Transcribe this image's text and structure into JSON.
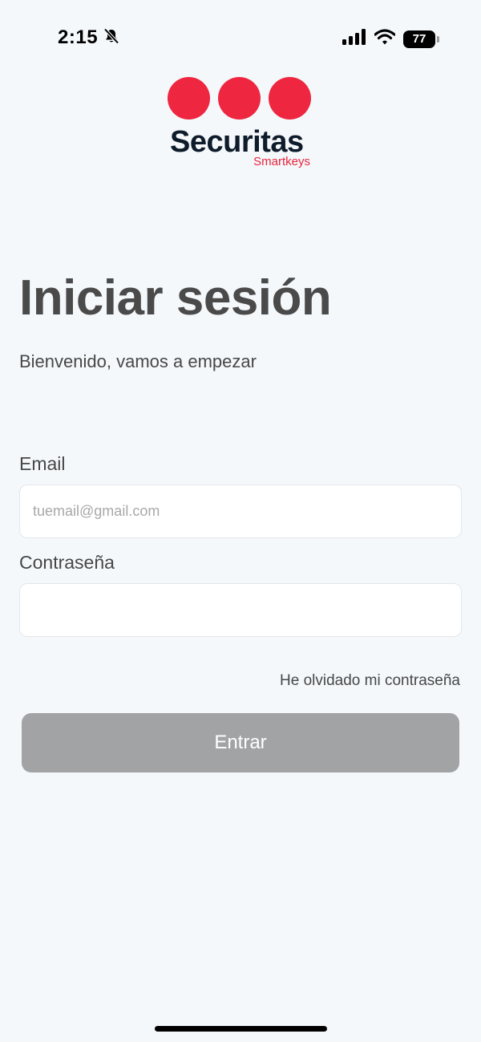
{
  "status_bar": {
    "time": "2:15",
    "battery_level": "77",
    "icons": [
      "bell-slash-icon",
      "signal-icon",
      "wifi-icon",
      "battery-icon"
    ]
  },
  "logo": {
    "text": "Securitas",
    "subtext": "Smartkeys",
    "dot_color": "#ee2640"
  },
  "header": {
    "title": "Iniciar sesión",
    "subtitle": "Bienvenido, vamos a empezar"
  },
  "form": {
    "email_label": "Email",
    "email_placeholder": "tuemail@gmail.com",
    "email_value": "",
    "password_label": "Contraseña",
    "password_placeholder": "",
    "password_value": "",
    "forgot_password": "He olvidado mi contraseña",
    "submit_label": "Entrar"
  },
  "colors": {
    "background": "#f5f8fb",
    "brand_red": "#ee2640",
    "brand_navy": "#0d1b2a",
    "button_disabled": "#a2a3a5"
  }
}
